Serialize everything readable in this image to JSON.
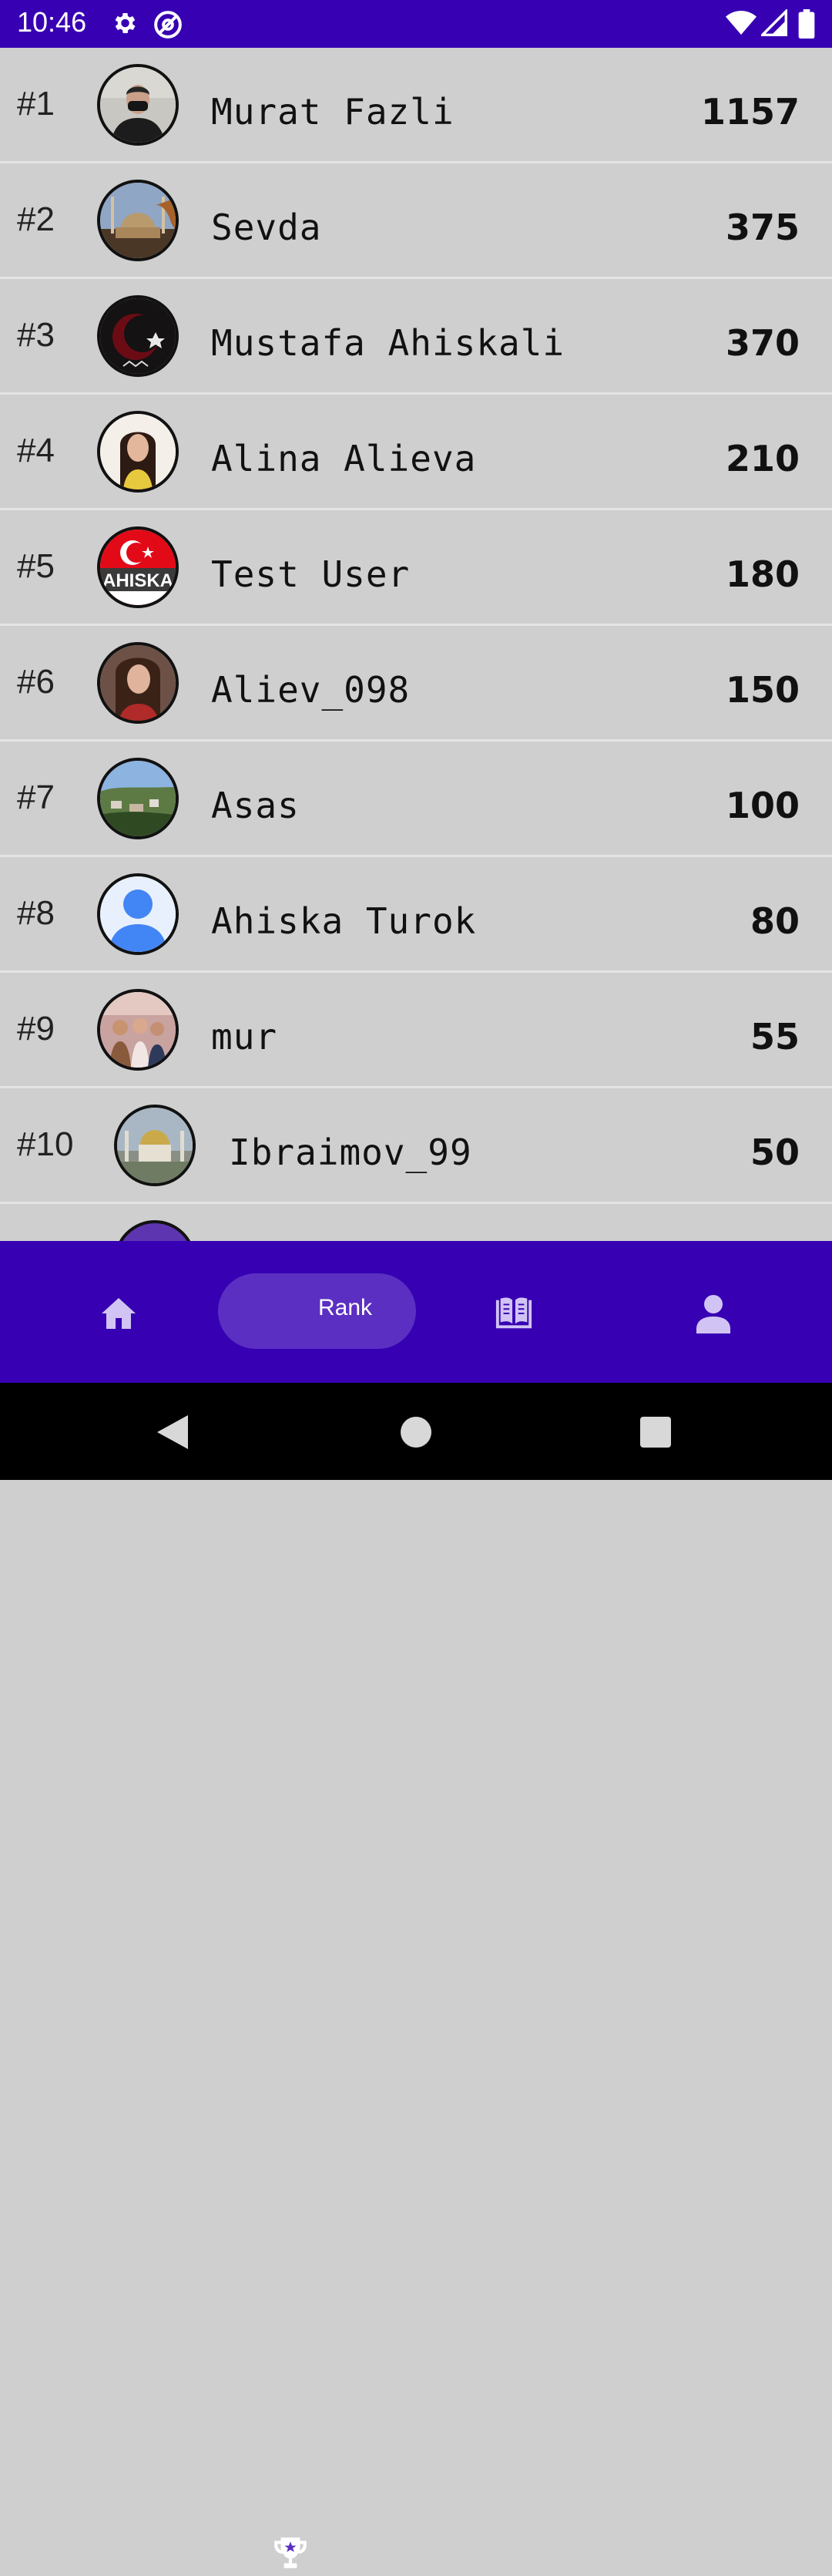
{
  "status_bar": {
    "time": "10:46",
    "icons": [
      "settings-icon",
      "at-sign-icon",
      "wifi-icon",
      "signal-icon",
      "battery-icon"
    ]
  },
  "leaderboard": [
    {
      "rank": "#1",
      "name": "Murat Fazli",
      "score": "1157",
      "avatar": "portrait-masked-man"
    },
    {
      "rank": "#2",
      "name": "Sevda",
      "score": "375",
      "avatar": "mosque-photo"
    },
    {
      "rank": "#3",
      "name": "Mustafa Ahiskali",
      "score": "370",
      "avatar": "crescent-star-emblem"
    },
    {
      "rank": "#4",
      "name": "Alina Alieva",
      "score": "210",
      "avatar": "portrait-woman"
    },
    {
      "rank": "#5",
      "name": "Test User",
      "score": "180",
      "avatar": "ahiska-flag-logo"
    },
    {
      "rank": "#6",
      "name": "Aliev_098",
      "score": "150",
      "avatar": "portrait-woman-selfie"
    },
    {
      "rank": "#7",
      "name": "Asas",
      "score": "100",
      "avatar": "town-landscape"
    },
    {
      "rank": "#8",
      "name": "Ahiska Turok",
      "score": "80",
      "avatar": "default-user"
    },
    {
      "rank": "#9",
      "name": "mur",
      "score": "55",
      "avatar": "group-photo"
    },
    {
      "rank": "#10",
      "name": "Ibraimov_99",
      "score": "50",
      "avatar": "golden-dome-photo"
    }
  ],
  "bottom_nav": {
    "items": [
      {
        "name": "home",
        "icon": "home-icon",
        "label": ""
      },
      {
        "name": "rank",
        "icon": "trophy-icon",
        "label": "Rank",
        "selected": true
      },
      {
        "name": "library",
        "icon": "book-icon",
        "label": ""
      },
      {
        "name": "profile",
        "icon": "person-icon",
        "label": ""
      }
    ]
  },
  "colors": {
    "primary": "#3700b3",
    "selected_pill": "#5a2fc2",
    "row_bg": "#cfcfcf",
    "divider": "#e4e4e4",
    "nav_icon_inactive": "#d1c4f5"
  }
}
